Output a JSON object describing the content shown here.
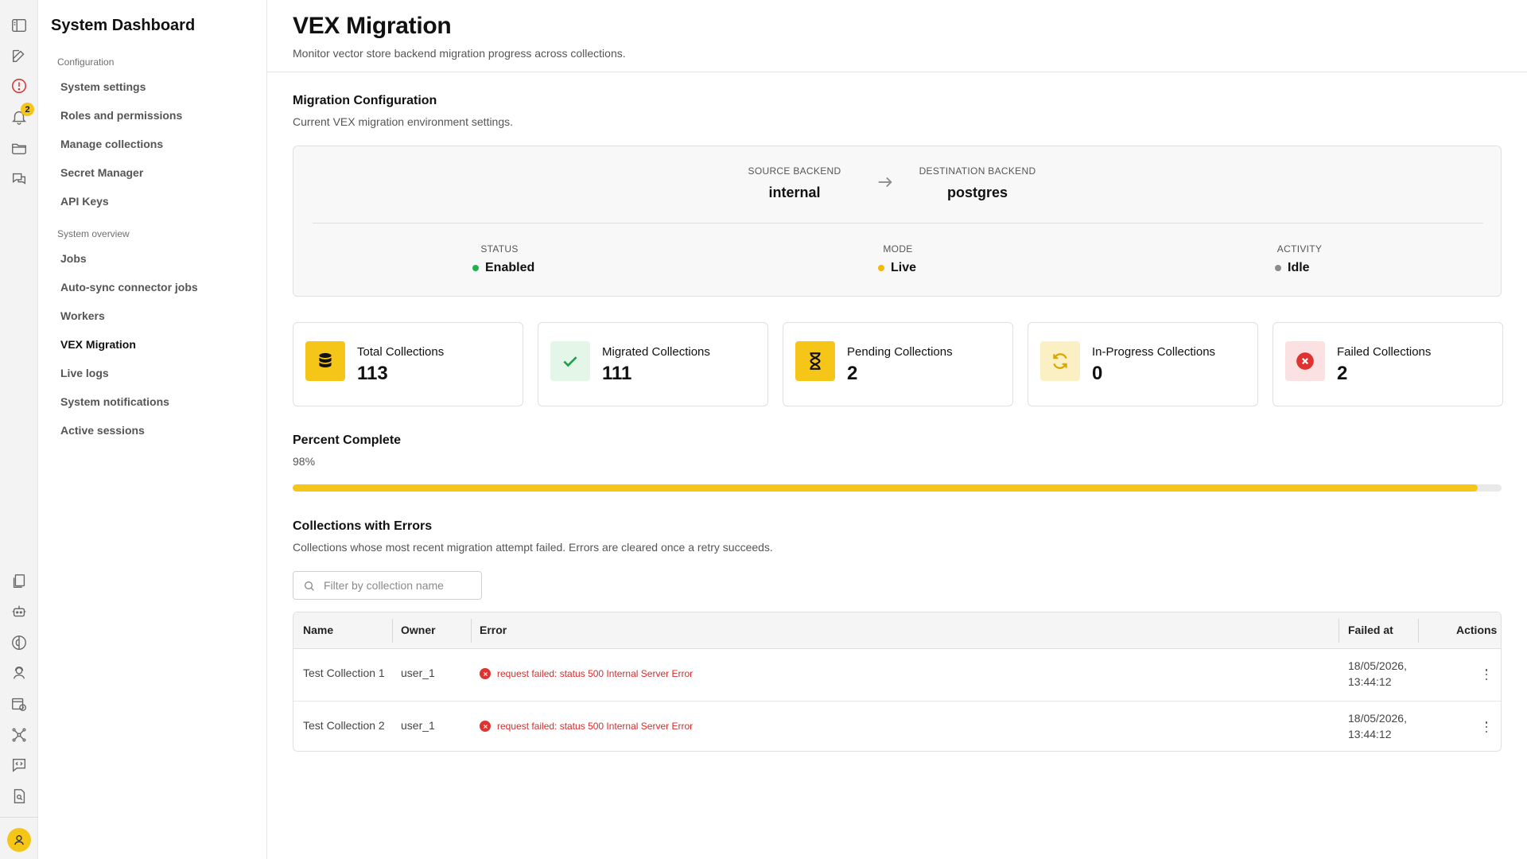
{
  "sidebar": {
    "title": "System Dashboard",
    "sections": [
      {
        "label": "Configuration",
        "items": [
          "System settings",
          "Roles and permissions",
          "Manage collections",
          "Secret Manager",
          "API Keys"
        ]
      },
      {
        "label": "System overview",
        "items": [
          "Jobs",
          "Auto-sync connector jobs",
          "Workers",
          "VEX Migration",
          "Live logs",
          "System notifications",
          "Active sessions"
        ]
      }
    ],
    "active_item": "VEX Migration"
  },
  "rail": {
    "notification_count": "2",
    "icons": [
      "sidebar-toggle-icon",
      "edit-icon",
      "alert-icon",
      "bell-icon",
      "folder-icon",
      "chat-icon",
      "documents-icon",
      "robot-icon",
      "brain-icon",
      "support-icon",
      "calendar-icon",
      "network-icon",
      "code-chat-icon",
      "file-search-icon",
      "user-icon"
    ]
  },
  "header": {
    "title": "VEX Migration",
    "subtitle": "Monitor vector store backend migration progress across collections."
  },
  "config": {
    "title": "Migration Configuration",
    "description": "Current VEX migration environment settings.",
    "source_label": "SOURCE BACKEND",
    "source_value": "internal",
    "destination_label": "DESTINATION BACKEND",
    "destination_value": "postgres",
    "status_label": "STATUS",
    "status_value": "Enabled",
    "mode_label": "MODE",
    "mode_value": "Live",
    "activity_label": "ACTIVITY",
    "activity_value": "Idle",
    "colors": {
      "enabled": "#22b14c",
      "live": "#f5b800",
      "idle": "#8c8c8c"
    }
  },
  "stats": [
    {
      "label": "Total Collections",
      "value": "113",
      "icon": "database-icon",
      "bg": "#f5c518",
      "fg": "#111111"
    },
    {
      "label": "Migrated Collections",
      "value": "111",
      "icon": "check-icon",
      "bg": "#e3f6e8",
      "fg": "#1f9e4a"
    },
    {
      "label": "Pending Collections",
      "value": "2",
      "icon": "hourglass-icon",
      "bg": "#f5c518",
      "fg": "#111111"
    },
    {
      "label": "In-Progress Collections",
      "value": "0",
      "icon": "refresh-icon",
      "bg": "#fbf0c4",
      "fg": "#d8a500"
    },
    {
      "label": "Failed Collections",
      "value": "2",
      "icon": "error-icon",
      "bg": "#fbe1e1",
      "fg": "#e0332f"
    }
  ],
  "progress": {
    "title": "Percent Complete",
    "label": "98%",
    "fraction": 0.98,
    "color": "#f5c518"
  },
  "errors": {
    "title": "Collections with Errors",
    "description": "Collections whose most recent migration attempt failed. Errors are cleared once a retry succeeds.",
    "filter_placeholder": "Filter by collection name",
    "columns": [
      "Name",
      "Owner",
      "Error",
      "Failed at",
      "Actions"
    ],
    "rows": [
      {
        "name": "Test Collection 1",
        "owner": "user_1",
        "error": "request failed: status 500 Internal Server Error",
        "failed_date": "18/05/2026,",
        "failed_time": "13:44:12"
      },
      {
        "name": "Test Collection 2",
        "owner": "user_1",
        "error": "request failed: status 500 Internal Server Error",
        "failed_date": "18/05/2026,",
        "failed_time": "13:44:12"
      }
    ]
  }
}
